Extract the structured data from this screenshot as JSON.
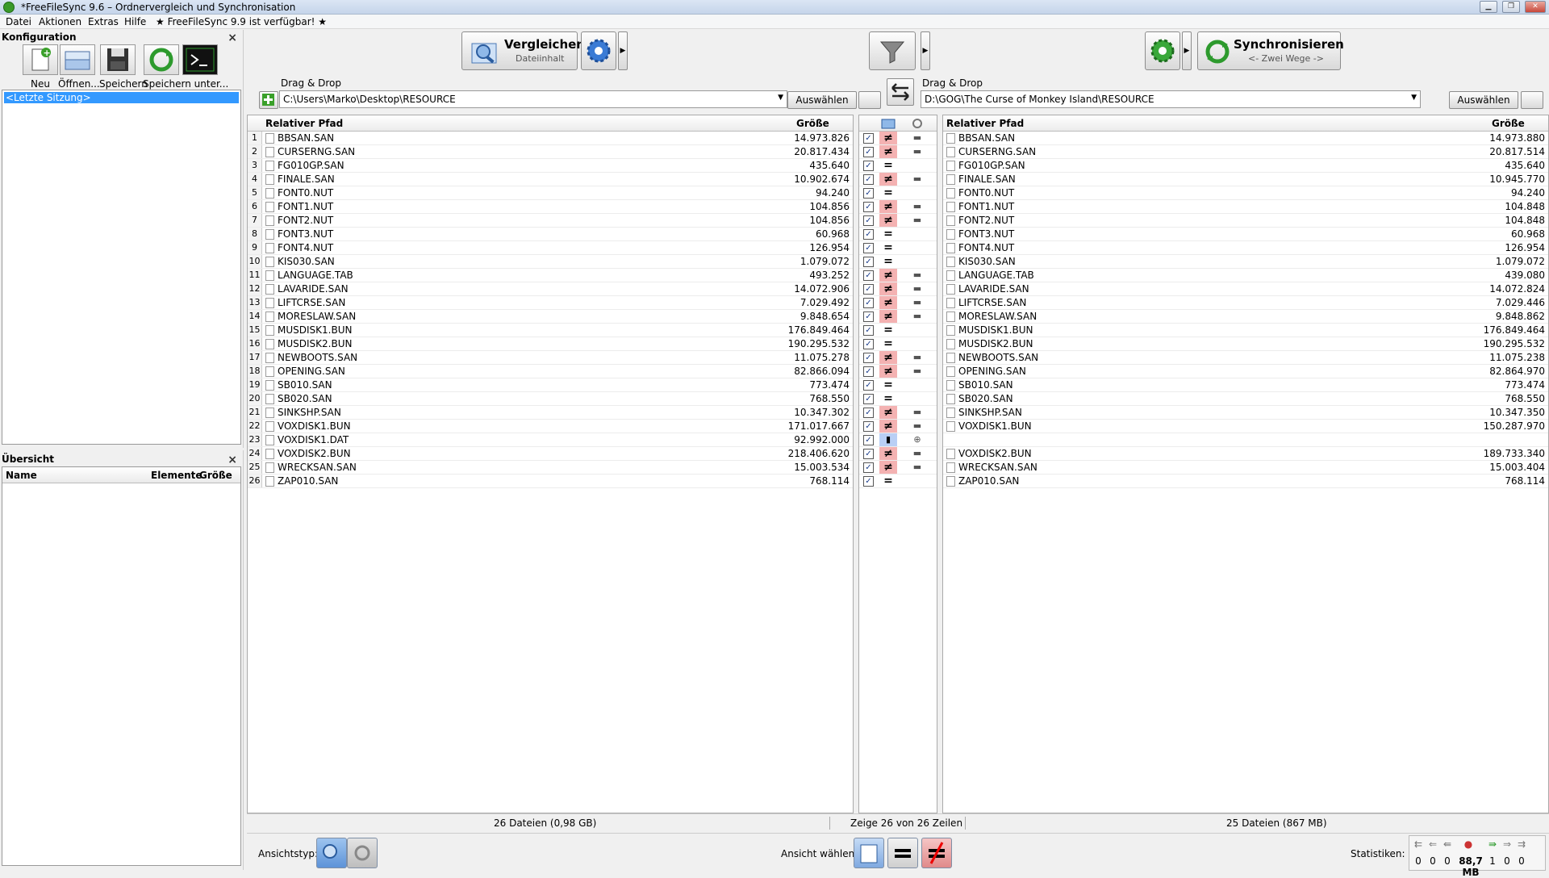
{
  "window": {
    "title": "*FreeFileSync 9.6 – Ordnervergleich und Synchronisation"
  },
  "menu": [
    "Datei",
    "Aktionen",
    "Extras",
    "Hilfe",
    "★ FreeFileSync 9.9 ist verfügbar! ★"
  ],
  "config_panel": {
    "title": "Konfiguration",
    "buttons": [
      "Neu",
      "Öffnen...",
      "Speichern",
      "Speichern unter..."
    ],
    "session": "<Letzte Sitzung>"
  },
  "overview_panel": {
    "title": "Übersicht",
    "columns": [
      "Name",
      "Elemente",
      "Größe"
    ]
  },
  "toolbar": {
    "compare_label": "Vergleichen",
    "compare_sub": "Dateiinhalt",
    "sync_label": "Synchronisieren",
    "sync_sub": "<- Zwei Wege ->"
  },
  "left_folder": {
    "dd_label": "Drag & Drop",
    "path": "C:\\Users\\Marko\\Desktop\\RESOURCE",
    "select_label": "Auswählen"
  },
  "right_folder": {
    "dd_label": "Drag & Drop",
    "path": "D:\\GOG\\The Curse of Monkey Island\\RESOURCE",
    "select_label": "Auswählen"
  },
  "left_grid": {
    "col_path": "Relativer Pfad",
    "col_size": "Größe"
  },
  "right_grid": {
    "col_path": "Relativer Pfad",
    "col_size": "Größe"
  },
  "files_left": [
    [
      "BBSAN.SAN",
      "14.973.826"
    ],
    [
      "CURSERNG.SAN",
      "20.817.434"
    ],
    [
      "FG010GP.SAN",
      "435.640"
    ],
    [
      "FINALE.SAN",
      "10.902.674"
    ],
    [
      "FONT0.NUT",
      "94.240"
    ],
    [
      "FONT1.NUT",
      "104.856"
    ],
    [
      "FONT2.NUT",
      "104.856"
    ],
    [
      "FONT3.NUT",
      "60.968"
    ],
    [
      "FONT4.NUT",
      "126.954"
    ],
    [
      "KIS030.SAN",
      "1.079.072"
    ],
    [
      "LANGUAGE.TAB",
      "493.252"
    ],
    [
      "LAVARIDE.SAN",
      "14.072.906"
    ],
    [
      "LIFTCRSE.SAN",
      "7.029.492"
    ],
    [
      "MORESLAW.SAN",
      "9.848.654"
    ],
    [
      "MUSDISK1.BUN",
      "176.849.464"
    ],
    [
      "MUSDISK2.BUN",
      "190.295.532"
    ],
    [
      "NEWBOOTS.SAN",
      "11.075.278"
    ],
    [
      "OPENING.SAN",
      "82.866.094"
    ],
    [
      "SB010.SAN",
      "773.474"
    ],
    [
      "SB020.SAN",
      "768.550"
    ],
    [
      "SINKSHP.SAN",
      "10.347.302"
    ],
    [
      "VOXDISK1.BUN",
      "171.017.667"
    ],
    [
      "VOXDISK1.DAT",
      "92.992.000"
    ],
    [
      "VOXDISK2.BUN",
      "218.406.620"
    ],
    [
      "WRECKSAN.SAN",
      "15.003.534"
    ],
    [
      "ZAP010.SAN",
      "768.114"
    ]
  ],
  "files_right": [
    [
      "BBSAN.SAN",
      "14.973.880"
    ],
    [
      "CURSERNG.SAN",
      "20.817.514"
    ],
    [
      "FG010GP.SAN",
      "435.640"
    ],
    [
      "FINALE.SAN",
      "10.945.770"
    ],
    [
      "FONT0.NUT",
      "94.240"
    ],
    [
      "FONT1.NUT",
      "104.848"
    ],
    [
      "FONT2.NUT",
      "104.848"
    ],
    [
      "FONT3.NUT",
      "60.968"
    ],
    [
      "FONT4.NUT",
      "126.954"
    ],
    [
      "KIS030.SAN",
      "1.079.072"
    ],
    [
      "LANGUAGE.TAB",
      "439.080"
    ],
    [
      "LAVARIDE.SAN",
      "14.072.824"
    ],
    [
      "LIFTCRSE.SAN",
      "7.029.446"
    ],
    [
      "MORESLAW.SAN",
      "9.848.862"
    ],
    [
      "MUSDISK1.BUN",
      "176.849.464"
    ],
    [
      "MUSDISK2.BUN",
      "190.295.532"
    ],
    [
      "NEWBOOTS.SAN",
      "11.075.238"
    ],
    [
      "OPENING.SAN",
      "82.864.970"
    ],
    [
      "SB010.SAN",
      "773.474"
    ],
    [
      "SB020.SAN",
      "768.550"
    ],
    [
      "SINKSHP.SAN",
      "10.347.350"
    ],
    [
      "VOXDISK1.BUN",
      "150.287.970"
    ],
    [
      "",
      ""
    ],
    [
      "VOXDISK2.BUN",
      "189.733.340"
    ],
    [
      "WRECKSAN.SAN",
      "15.003.404"
    ],
    [
      "ZAP010.SAN",
      "768.114"
    ]
  ],
  "row_status": [
    "diff",
    "diff",
    "equal",
    "diff",
    "equal",
    "diff",
    "diff",
    "equal",
    "equal",
    "equal",
    "diff",
    "diff",
    "diff",
    "diff",
    "equal",
    "equal",
    "diff",
    "diff",
    "equal",
    "equal",
    "diff",
    "diff",
    "leftonly",
    "diff",
    "diff",
    "equal"
  ],
  "status": {
    "left": "26 Dateien (0,98 GB)",
    "middle": "Zeige 26 von 26 Zeilen",
    "right": "25 Dateien (867 MB)"
  },
  "bottom": {
    "view_type_label": "Ansichtstyp:",
    "view_select_label": "Ansicht wählen:",
    "stats_label": "Statistiken:",
    "stats": [
      "0",
      "0",
      "0",
      "88,7 MB",
      "1",
      "0",
      "0"
    ]
  },
  "colors": {
    "diff": "#f4b2b2",
    "leftonly": "#b9cff5",
    "selection": "#3399ff"
  }
}
